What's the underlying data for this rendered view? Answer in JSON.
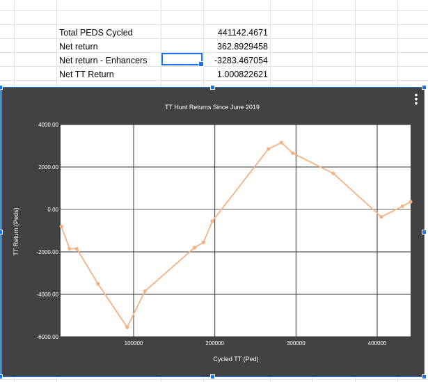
{
  "sheet": {
    "rows": [
      {
        "label": "Total PEDS Cycled",
        "value": "441142.4671"
      },
      {
        "label": "Net return",
        "value": "362.8929458"
      },
      {
        "label": "Net return - Enhancers",
        "value": "-3283.467054"
      },
      {
        "label": "Net TT Return",
        "value": "1.000822621"
      }
    ]
  },
  "chart_menu_icon": "vertical-ellipsis-icon",
  "colors": {
    "chart_background": "#424242",
    "plot_background": "#ffffff",
    "series_line": "#f4b183",
    "selection": "#1a73e8"
  },
  "chart_data": {
    "type": "line",
    "title": "TT Hunt Returns Since June 2019",
    "xlabel": "Cycled TT (Ped)",
    "ylabel": "TT Return (Peds)",
    "xlim": [
      10000,
      441142
    ],
    "ylim": [
      -6000,
      4000
    ],
    "x_ticks": [
      100000,
      200000,
      300000,
      400000
    ],
    "x_tick_labels": [
      "100000",
      "200000",
      "300000",
      "400000"
    ],
    "y_ticks": [
      4000,
      2000,
      0,
      -2000,
      -4000,
      -6000
    ],
    "y_tick_labels": [
      "4000.00",
      "2000.00",
      "0.00",
      "-2000.00",
      "-4000.00",
      "-6000.00"
    ],
    "grid": true,
    "legend": "none",
    "series": [
      {
        "x": [
          11000,
          21000,
          30000,
          56000,
          92000,
          114000,
          175000,
          186000,
          197000,
          266000,
          282000,
          296000,
          346000,
          405000,
          431000,
          441142
        ],
        "y": [
          -800,
          -1850,
          -1850,
          -3500,
          -5550,
          -3850,
          -1800,
          -1550,
          -550,
          2850,
          3150,
          2650,
          1700,
          -350,
          150,
          363
        ]
      }
    ]
  }
}
